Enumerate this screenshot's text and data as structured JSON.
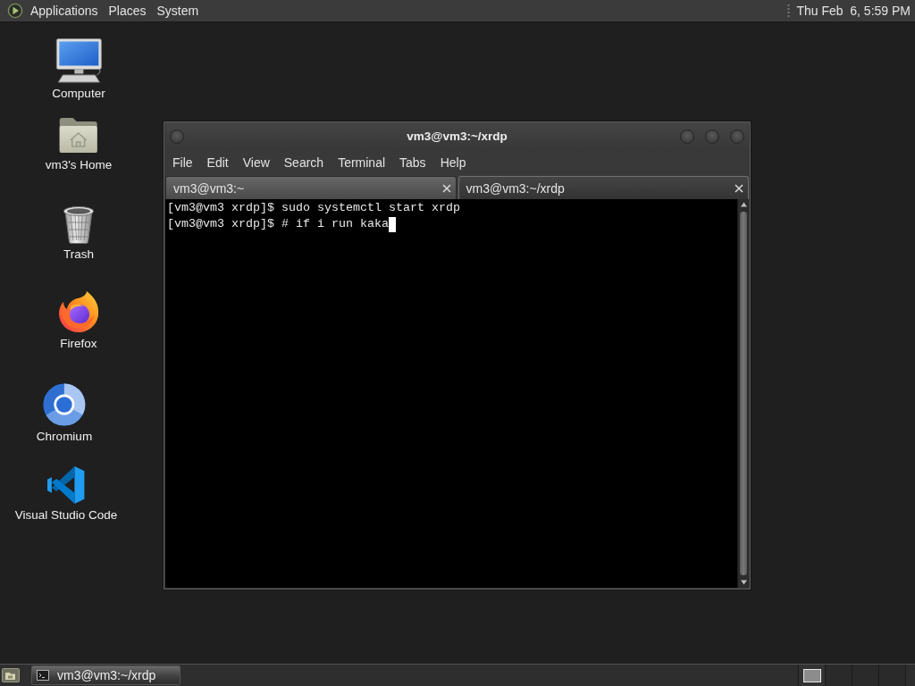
{
  "top_panel": {
    "menus": [
      "Applications",
      "Places",
      "System"
    ],
    "clock": "Thu Feb  6, 5:59 PM"
  },
  "desktop_icons": [
    {
      "label": "Computer",
      "kind": "computer"
    },
    {
      "label": "vm3's Home",
      "kind": "home"
    },
    {
      "label": "Trash",
      "kind": "trash"
    },
    {
      "label": "Firefox",
      "kind": "firefox"
    },
    {
      "label": "Chromium",
      "kind": "chromium"
    },
    {
      "label": "Visual Studio Code",
      "kind": "vscode"
    }
  ],
  "terminal_window": {
    "title": "vm3@vm3:~/xrdp",
    "menu": [
      "File",
      "Edit",
      "View",
      "Search",
      "Terminal",
      "Tabs",
      "Help"
    ],
    "tabs": [
      {
        "label": "vm3@vm3:~",
        "selected": false
      },
      {
        "label": "vm3@vm3:~/xrdp",
        "selected": true
      }
    ],
    "lines": [
      "[vm3@vm3 xrdp]$ sudo systemctl start xrdp",
      "[vm3@vm3 xrdp]$ # if i run kaka"
    ],
    "cursor": true
  },
  "bottom_panel": {
    "tasks": [
      {
        "label": "vm3@vm3:~/xrdp",
        "selected": true
      }
    ]
  }
}
